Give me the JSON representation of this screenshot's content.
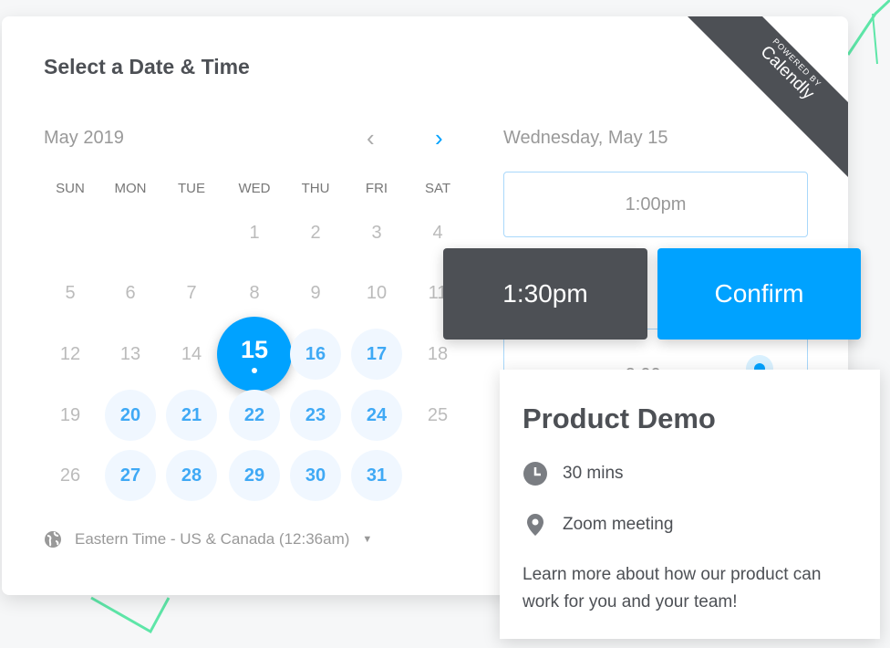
{
  "header": {
    "title": "Select a Date & Time"
  },
  "branding": {
    "powered_by": "POWERED BY",
    "name": "Calendly"
  },
  "calendar": {
    "month": "May 2019",
    "prev_icon": "chevron-left-icon",
    "next_icon": "chevron-right-icon",
    "weekdays": [
      "SUN",
      "MON",
      "TUE",
      "WED",
      "THU",
      "FRI",
      "SAT"
    ],
    "weeks": [
      [
        "",
        "",
        "",
        "1",
        "2",
        "3",
        "4"
      ],
      [
        "5",
        "6",
        "7",
        "8",
        "9",
        "10",
        "11"
      ],
      [
        "12",
        "13",
        "14",
        "15",
        "16",
        "17",
        "18"
      ],
      [
        "19",
        "20",
        "21",
        "22",
        "23",
        "24",
        "25"
      ],
      [
        "26",
        "27",
        "28",
        "29",
        "30",
        "31",
        ""
      ]
    ],
    "available": [
      "16",
      "17",
      "20",
      "21",
      "22",
      "23",
      "24",
      "27",
      "28",
      "29",
      "30",
      "31"
    ],
    "selected": "15"
  },
  "timezone": {
    "label": "Eastern Time - US & Canada (12:36am)"
  },
  "times": {
    "date": "Wednesday, May 15",
    "slots": [
      "1:00pm",
      "2:00pm"
    ],
    "selected": "1:30pm",
    "confirm": "Confirm"
  },
  "event": {
    "title": "Product Demo",
    "duration": "30 mins",
    "location": "Zoom meeting",
    "description": "Learn more about how our product can work for you and your team!"
  },
  "colors": {
    "accent": "#00a2ff",
    "dark": "#4d5055"
  }
}
